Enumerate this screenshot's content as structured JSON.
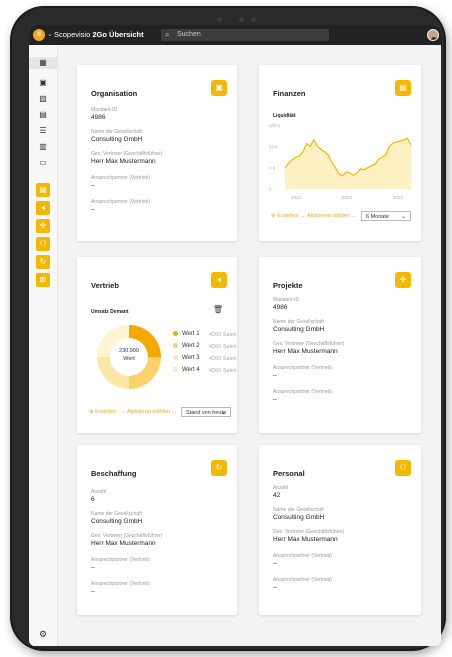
{
  "header": {
    "logo": "S",
    "app_name": "Scopevisio",
    "app_product": "2Go Übersicht",
    "search_placeholder": "Suchen"
  },
  "sidebar": {
    "nav_icons": [
      "grid-icon",
      "calendar-icon",
      "image-icon",
      "upload-icon",
      "list-icon",
      "table-icon",
      "chat-icon"
    ],
    "app_tiles": [
      "finance-tile-icon",
      "megaphone-tile-icon",
      "puzzle-tile-icon",
      "people-tile-icon",
      "refresh-tile-icon",
      "crossfunction-tile-icon"
    ]
  },
  "organisation": {
    "title": "Organisation",
    "fields": [
      {
        "label": "Mandant-ID",
        "value": "4986"
      },
      {
        "label": "Name der Gesellschaft",
        "value": "Consulting GmbH"
      },
      {
        "label": "Ges. Vertreter (Geschäftsführer)",
        "value": "Herr Max Mustermann"
      },
      {
        "label": "Ansprechpartner (Vertrieb)",
        "value": "–"
      },
      {
        "label": "Ansprechpartner (Vertrieb)",
        "value": "–"
      }
    ]
  },
  "finanzen": {
    "title": "Finanzen",
    "subtitle": "Liquidität",
    "create_label": "Erstellen",
    "filter_label": "Aktivieren wählen ...",
    "period": "6 Monate"
  },
  "vertrieb": {
    "title": "Vertrieb",
    "subtitle": "Umsatz Demant",
    "center_value": "230.900",
    "center_label": "Wert",
    "create_label": "Erstellen",
    "filter_label": "Aktivieren wählen ...",
    "stand": "Stand von heute"
  },
  "projekte": {
    "title": "Projekte",
    "fields": [
      {
        "label": "Mandant-ID",
        "value": "4986"
      },
      {
        "label": "Name der Gesellschaft",
        "value": "Consulting GmbH"
      },
      {
        "label": "Ges. Vertreter (Geschäftsführer)",
        "value": "Herr Max Mustermann"
      },
      {
        "label": "Ansprechpartner (Vertrieb)",
        "value": "–"
      },
      {
        "label": "Ansprechpartner (Vertrieb)",
        "value": "–"
      }
    ]
  },
  "beschaffung": {
    "title": "Beschaffung",
    "fields": [
      {
        "label": "Anzahl",
        "value": "6"
      },
      {
        "label": "Name der Gesellschaft",
        "value": "Consulting GmbH"
      },
      {
        "label": "Ges. Vertreter (Geschäftsführer)",
        "value": "Herr Max Mustermann"
      },
      {
        "label": "Ansprechpartner (Vertrieb)",
        "value": "–"
      },
      {
        "label": "Ansprechpartner (Vertrieb)",
        "value": "–"
      }
    ]
  },
  "personal": {
    "title": "Personal",
    "fields": [
      {
        "label": "Anzahl",
        "value": "42"
      },
      {
        "label": "Name der Gesellschaft",
        "value": "Consulting GmbH"
      },
      {
        "label": "Ges. Vertreter (Geschäftsführer)",
        "value": "Herr Max Mustermann"
      },
      {
        "label": "Ansprechpartner (Vertrieb)",
        "value": "–"
      },
      {
        "label": "Ansprechpartner (Vertrieb)",
        "value": "–"
      }
    ]
  },
  "colors": {
    "accent": "#f5b800",
    "accent_text": "#f5a623",
    "line": "#f5b800",
    "area": "#fdf0c2",
    "donut": [
      "#f5a800",
      "#fbd26a",
      "#fde7a8",
      "#fff3d1"
    ]
  },
  "chart_data": [
    {
      "type": "area",
      "title": "Liquidität",
      "ylabel": "",
      "yticks": [
        "100 k",
        "50 k",
        "0 k",
        "0"
      ],
      "xticks": [
        "2022",
        "2022",
        "2022"
      ],
      "ylim": [
        0,
        120
      ],
      "x": [
        0,
        1,
        2,
        3,
        4,
        5,
        6,
        7,
        8,
        9,
        10,
        11,
        12,
        13,
        14,
        15,
        16,
        17,
        18,
        19,
        20,
        21,
        22,
        23,
        24,
        25,
        26,
        27,
        28,
        29,
        30,
        31,
        32,
        33,
        34,
        35
      ],
      "values": [
        40,
        48,
        55,
        60,
        62,
        70,
        85,
        80,
        92,
        80,
        74,
        70,
        64,
        50,
        40,
        28,
        25,
        32,
        30,
        26,
        30,
        38,
        36,
        40,
        44,
        46,
        56,
        60,
        64,
        80,
        86,
        88,
        90,
        92,
        95,
        82
      ]
    },
    {
      "type": "pie",
      "title": "Umsatz Demant",
      "series": [
        {
          "name": "Wert 1",
          "value": 4260,
          "label": "4260 Sales"
        },
        {
          "name": "Wert 2",
          "value": 4260,
          "label": "4260 Sales"
        },
        {
          "name": "Wert 3",
          "value": 4260,
          "label": "4260 Sales"
        },
        {
          "name": "Wert 4",
          "value": 4260,
          "label": "4260 Sales"
        }
      ]
    }
  ]
}
